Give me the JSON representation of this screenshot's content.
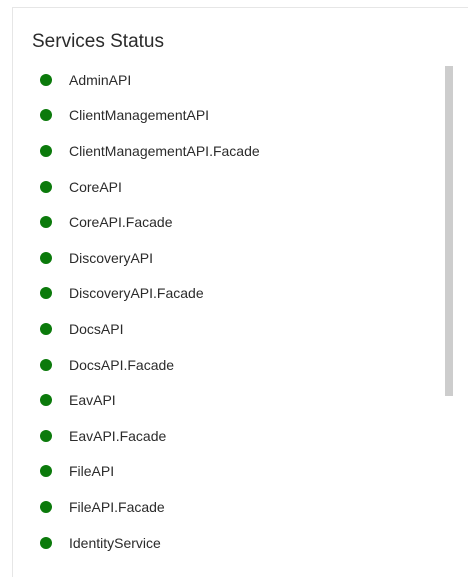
{
  "panel": {
    "title": "Services Status"
  },
  "colors": {
    "status_ok": "#0b7a0b",
    "scrollbar_thumb": "#cdcdcd"
  },
  "services": [
    {
      "name": "AdminAPI",
      "status": "ok"
    },
    {
      "name": "ClientManagementAPI",
      "status": "ok"
    },
    {
      "name": "ClientManagementAPI.Facade",
      "status": "ok"
    },
    {
      "name": "CoreAPI",
      "status": "ok"
    },
    {
      "name": "CoreAPI.Facade",
      "status": "ok"
    },
    {
      "name": "DiscoveryAPI",
      "status": "ok"
    },
    {
      "name": "DiscoveryAPI.Facade",
      "status": "ok"
    },
    {
      "name": "DocsAPI",
      "status": "ok"
    },
    {
      "name": "DocsAPI.Facade",
      "status": "ok"
    },
    {
      "name": "EavAPI",
      "status": "ok"
    },
    {
      "name": "EavAPI.Facade",
      "status": "ok"
    },
    {
      "name": "FileAPI",
      "status": "ok"
    },
    {
      "name": "FileAPI.Facade",
      "status": "ok"
    },
    {
      "name": "IdentityService",
      "status": "ok"
    }
  ]
}
